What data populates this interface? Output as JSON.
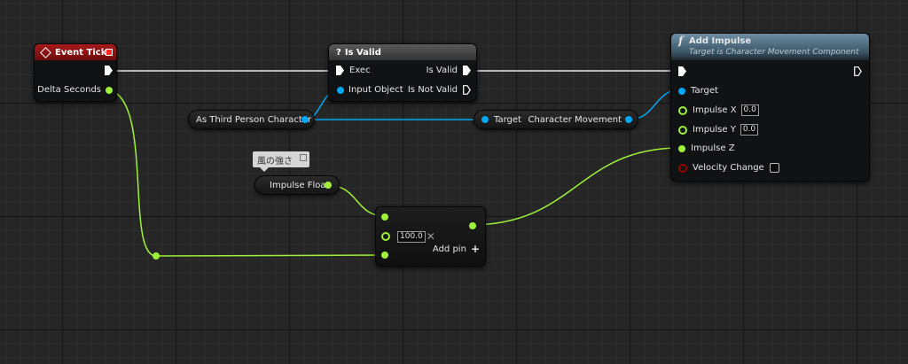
{
  "colors": {
    "exec": "#ffffff",
    "float": "#9ef23a",
    "object": "#00a8f3",
    "bool": "#950000",
    "event_header": "#8e1414",
    "isvalid_header": "#4a4a4a",
    "function_header": "#5e7b8f"
  },
  "nodes": {
    "event_tick": {
      "title": "Event Tick",
      "icon": "event-diamond-icon",
      "pin_delta": "Delta Seconds"
    },
    "is_valid": {
      "title": "Is Valid",
      "icon": "question-mark-icon",
      "pin_exec": "Exec",
      "pin_input": "Input Object",
      "pin_valid": "Is Valid",
      "pin_not_valid": "Is Not Valid"
    },
    "get_character": {
      "label": "As Third Person Character"
    },
    "get_movement": {
      "pin_target": "Target",
      "label": "Character Movement"
    },
    "comment": {
      "text": "風の強さ"
    },
    "impulse_float": {
      "label": "Impulse Float"
    },
    "multiply": {
      "value": "100.0",
      "add_pin": "Add pin",
      "add_icon": "plus-icon",
      "remove_icon": "x-icon"
    },
    "add_impulse": {
      "title": "Add Impulse",
      "subtitle": "Target is Character Movement Component",
      "icon": "function-icon",
      "pin_target": "Target",
      "pin_x": "Impulse X",
      "x_value": "0.0",
      "pin_y": "Impulse Y",
      "y_value": "0.0",
      "pin_z": "Impulse Z",
      "pin_velocity": "Velocity Change"
    }
  }
}
